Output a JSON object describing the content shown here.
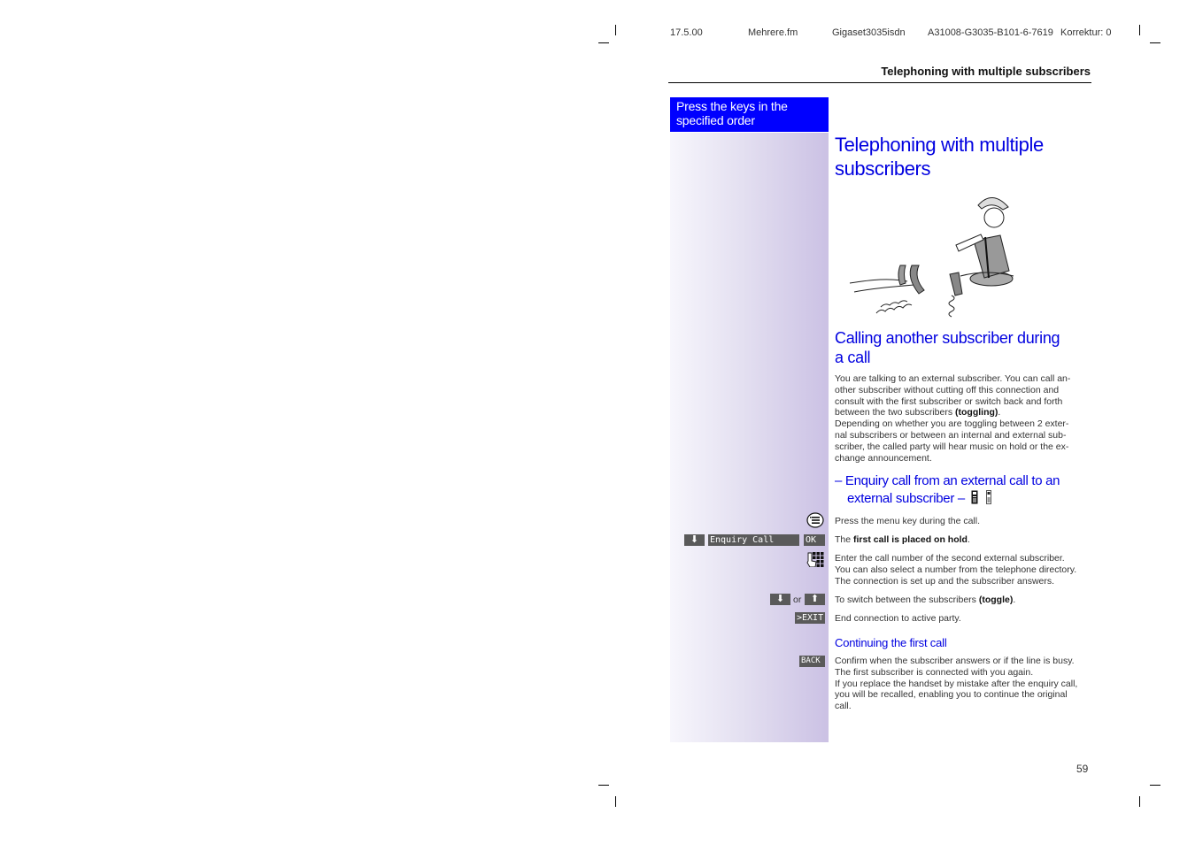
{
  "print_header": {
    "date": "17.5.00",
    "file": "Mehrere.fm",
    "product": "Gigaset3035isdn",
    "doc_id": "A31008-G3035-B101-6-7619",
    "correction": "Korrektur: 0"
  },
  "running_title": "Telephoning with multiple subscribers",
  "key_instructions_box": {
    "line1": "Press the keys in the",
    "line2": "specified order"
  },
  "main_heading": {
    "line1": "Telephoning with multiple",
    "line2": "subscribers"
  },
  "illustration": {
    "description": "Man in hat sitting cross-legged playing a flute beside phone handsets",
    "icon": "flute-player-illustration"
  },
  "section": {
    "heading_line1": "Calling another subscriber during",
    "heading_line2": "a call",
    "intro_paragraphs": [
      {
        "lines": [
          "You are talking to an external subscriber. You can call an-",
          "other subscriber without cutting off this connection and",
          "consult with the first subscriber or switch back and forth"
        ],
        "last_line_prefix": "between the two subscribers ",
        "last_line_bold": "(toggling)",
        "last_line_suffix": "."
      },
      {
        "lines": [
          "Depending on whether you are toggling between 2 exter-",
          "nal subscribers or between an internal and external sub-",
          "scriber, the called party will hear music on hold or the ex-",
          "change announcement."
        ]
      }
    ]
  },
  "subsection": {
    "heading_line1": "– Enquiry call from an external call to an",
    "heading_line2": "external subscriber –",
    "heading_icons": [
      "handset-icon-dark",
      "handset-icon-light"
    ]
  },
  "steps": [
    {
      "key_icon": "menu-key-icon",
      "text": "Press the menu key during the call."
    },
    {
      "key_icon": "down-arrow-key-icon",
      "display_text": "Enquiry Call",
      "softkey": "OK",
      "text_prefix": "The ",
      "text_bold": "first call is placed on hold",
      "text_suffix": "."
    },
    {
      "key_icon": "keypad-icon",
      "lines": [
        "Enter the call number of the second external subscriber.",
        "You can also select a number from the telephone directory.",
        "The connection is set up and the subscriber answers."
      ]
    },
    {
      "key_icon": "down-up-arrow-keys",
      "or_label": "or",
      "text_prefix": "To switch between the subscribers ",
      "text_bold": "(toggle)",
      "text_suffix": "."
    },
    {
      "softkey": ">EXIT",
      "text": "End connection to active party."
    }
  ],
  "continuing": {
    "heading": "Continuing the first call",
    "softkey": "BACK",
    "lines": [
      "Confirm when the subscriber answers or if the line is busy.",
      "The first subscriber is connected with you again.",
      "If you replace the handset by mistake after the enquiry call,",
      "you will be recalled, enabling you to continue the original",
      "call."
    ]
  },
  "page_number": "59",
  "colors": {
    "heading_blue": "#0000e0",
    "key_box_blue": "#0000ff",
    "sidebar_light": "#f7f6fc",
    "sidebar_dark": "#cbc1e4",
    "display_gray": "#5a5a5a"
  }
}
